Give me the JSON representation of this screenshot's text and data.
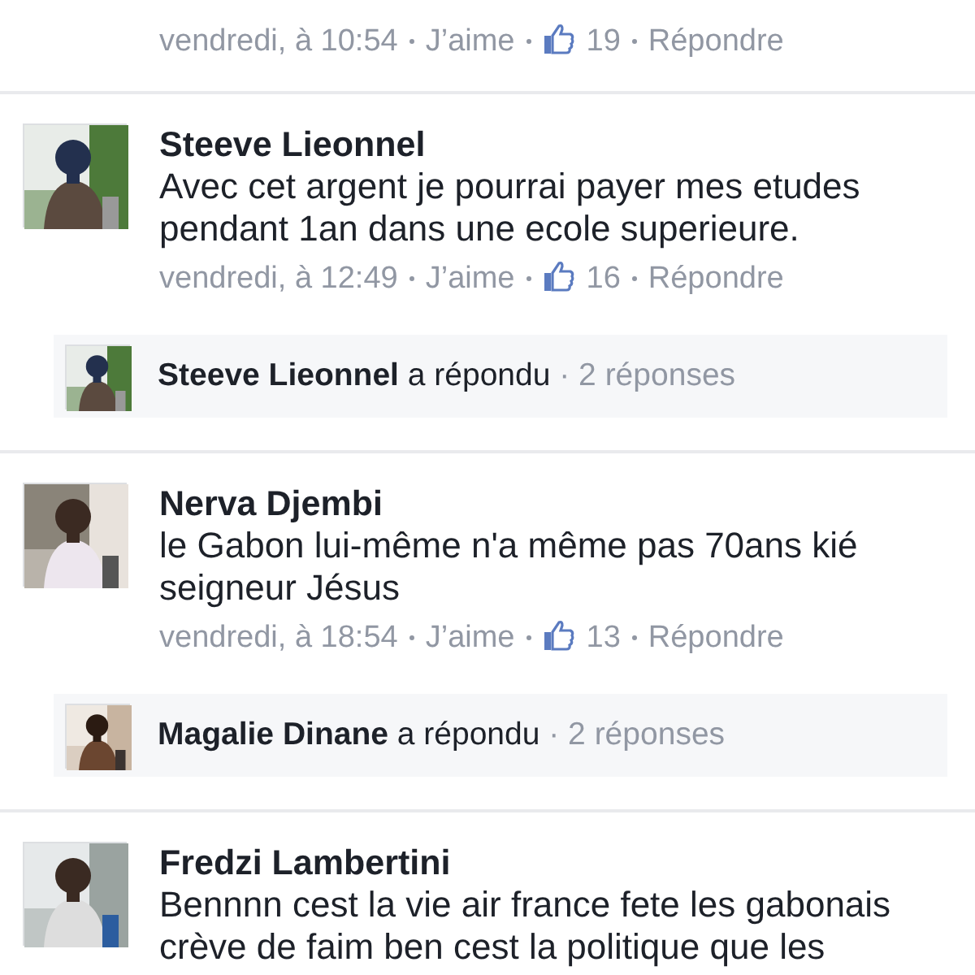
{
  "top_meta": {
    "time": "vendredi, à 10:54",
    "like": "J’aime",
    "likes": "19",
    "reply": "Répondre"
  },
  "comments": [
    {
      "name": "Steeve Lieonnel",
      "text": "Avec cet argent je pourrai payer mes etudes pendant 1an dans une ecole superieure.",
      "time": "vendredi, à 12:49",
      "like": "J’aime",
      "likes": "16",
      "reply": "Répondre",
      "replies": {
        "name": "Steeve Lieonnel",
        "action": "a répondu",
        "count": "· 2 réponses"
      }
    },
    {
      "name": "Nerva Djembi",
      "text": "le Gabon lui-même n'a même pas 70ans kié seigneur Jésus",
      "time": "vendredi, à 18:54",
      "like": "J’aime",
      "likes": "13",
      "reply": "Répondre",
      "replies": {
        "name": "Magalie Dinane",
        "action": "a répondu",
        "count": "· 2 réponses"
      }
    },
    {
      "name": "Fredzi Lambertini",
      "text": "Bennnn cest la vie air france fete les gabonais crève de faim ben cest la politique que les"
    }
  ]
}
